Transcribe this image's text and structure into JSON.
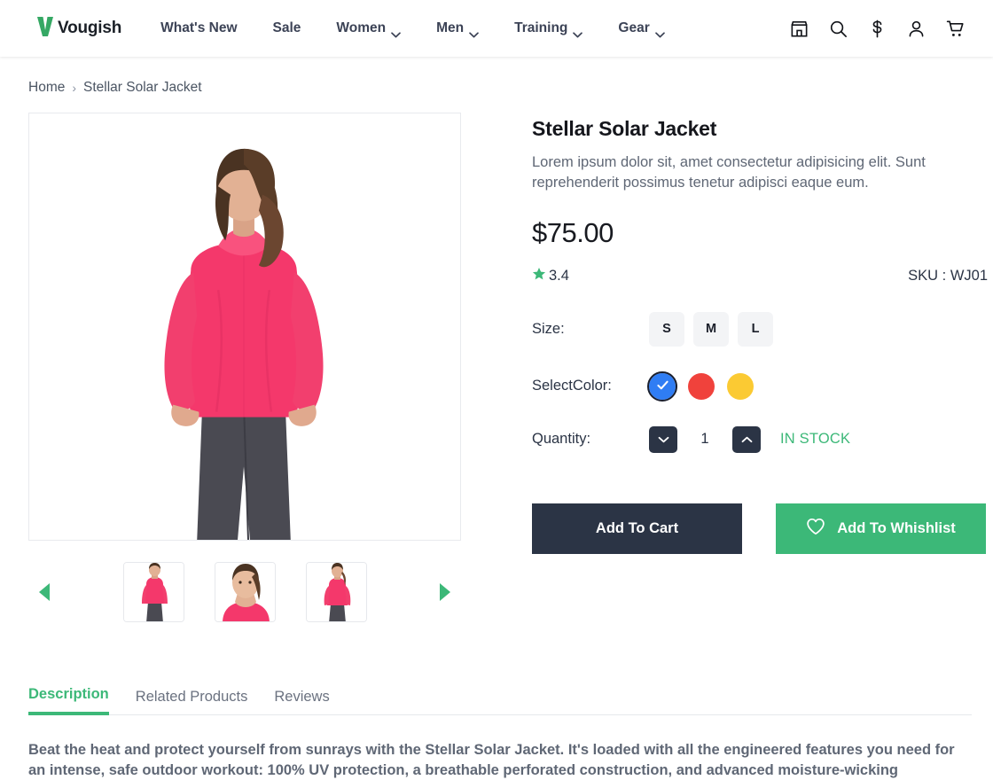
{
  "header": {
    "logo_text": "Vougish",
    "logo_color": "#3cb878",
    "nav": [
      {
        "label": "What's New",
        "has_dropdown": false
      },
      {
        "label": "Sale",
        "has_dropdown": false
      },
      {
        "label": "Women",
        "has_dropdown": true
      },
      {
        "label": "Men",
        "has_dropdown": true
      },
      {
        "label": "Training",
        "has_dropdown": true
      },
      {
        "label": "Gear",
        "has_dropdown": true
      }
    ],
    "icons": [
      {
        "name": "store-icon"
      },
      {
        "name": "search-icon"
      },
      {
        "name": "currency-dollar-icon"
      },
      {
        "name": "user-account-icon"
      },
      {
        "name": "shopping-cart-icon"
      }
    ]
  },
  "breadcrumb": {
    "home": "Home",
    "separator": "›",
    "current": "Stellar Solar Jacket"
  },
  "gallery": {
    "prev_label": "Previous image",
    "next_label": "Next image",
    "thumbnails": [
      {
        "alt": "Model wearing pink jacket, full front view"
      },
      {
        "alt": "Close up of model in pink jacket"
      },
      {
        "alt": "Model wearing pink jacket, back view"
      }
    ],
    "main_image_alt": "Stellar Solar Jacket back view on model"
  },
  "product": {
    "title": "Stellar Solar Jacket",
    "description": "Lorem ipsum dolor sit, amet consectetur adipisicing elit. Sunt reprehenderit possimus tenetur adipisci eaque eum.",
    "price": "$75.00",
    "rating": "3.4",
    "sku": "SKU : WJ01",
    "size": {
      "label": "Size:",
      "options": [
        "S",
        "M",
        "L"
      ],
      "selected": null
    },
    "color": {
      "label": "SelectColor:",
      "options": [
        {
          "name": "blue",
          "hex": "#2f7df4",
          "selected": true
        },
        {
          "name": "red",
          "hex": "#f0423c",
          "selected": false
        },
        {
          "name": "yellow",
          "hex": "#fbca33",
          "selected": false
        }
      ]
    },
    "quantity": {
      "label": "Quantity:",
      "value": "1",
      "decrease_label": "Decrease quantity",
      "increase_label": "Increase quantity"
    },
    "stock_status": "IN STOCK",
    "add_to_cart": "Add To Cart",
    "add_to_wishlist": "Add To Whishlist"
  },
  "tabs": {
    "items": [
      {
        "label": "Description",
        "active": true
      },
      {
        "label": "Related Products",
        "active": false
      },
      {
        "label": "Reviews",
        "active": false
      }
    ],
    "description_body": "Beat the heat and protect yourself from sunrays with the Stellar Solar Jacket. It's loaded with all the engineered features you need for an intense, safe outdoor workout: 100% UV protection, a breathable perforated construction, and advanced moisture-wicking"
  },
  "colors": {
    "accent_green": "#3cb878",
    "dark_navy": "#2b3445",
    "jacket_pink": "#f4386b"
  }
}
